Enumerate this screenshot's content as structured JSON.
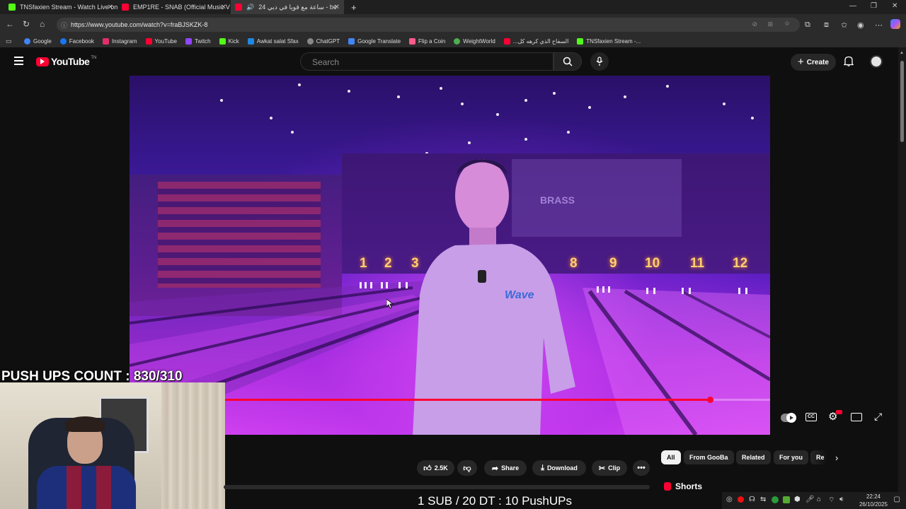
{
  "browser": {
    "tabs": [
      {
        "title": "TNSfaxien Stream - Watch Live on",
        "favicon_color": "#53fc18"
      },
      {
        "title": "EMP1RE - SNAB (Official Music V",
        "favicon_color": "#ff0033"
      },
      {
        "title": "24 ساعة مع قويا في دبي - be",
        "favicon_color": "#ff0033"
      }
    ],
    "new_tab": "+",
    "url": "https://www.youtube.com/watch?v=fraBJSKZK-8",
    "bookmarks": [
      {
        "label": "Google",
        "color": "#4285f4"
      },
      {
        "label": "Facebook",
        "color": "#1877f2"
      },
      {
        "label": "Instagram",
        "color": "#e1306c"
      },
      {
        "label": "YouTube",
        "color": "#ff0033"
      },
      {
        "label": "Twitch",
        "color": "#9146ff"
      },
      {
        "label": "Kick",
        "color": "#53fc18"
      },
      {
        "label": "Awkat salat Sfax",
        "color": "#1e88e5"
      },
      {
        "label": "ChatGPT",
        "color": "#888888"
      },
      {
        "label": "Google Translate",
        "color": "#4285f4"
      },
      {
        "label": "Flip a Coin",
        "color": "#ff5a8a"
      },
      {
        "label": "WeightWorld",
        "color": "#4caf50"
      },
      {
        "label": "...السفاح الذي كرهه كل",
        "color": "#ff0033"
      },
      {
        "label": "TNSfaxien Stream -...",
        "color": "#53fc18"
      }
    ]
  },
  "youtube": {
    "logo_text": "YouTube",
    "logo_sup": "TN",
    "search_placeholder": "Search",
    "create_label": "Create",
    "actions": {
      "likes": "2.5K",
      "share": "Share",
      "download": "Download",
      "clip": "Clip"
    },
    "chips": [
      "All",
      "From GooBa",
      "Related",
      "For you",
      "Re"
    ],
    "shorts_label": "Shorts",
    "progress_fraction": 0.89,
    "lane_numbers": [
      "1",
      "2",
      "3",
      "8",
      "9",
      "10",
      "11",
      "12"
    ],
    "shirt_text": "Wave",
    "poster_text": "BRASS"
  },
  "overlay": {
    "pushups_count": "PUSH UPS COUNT : 830/310",
    "subs_rule": "1 SUB / 20 DT : 10 PushUPs"
  },
  "tray": {
    "time": "22:24",
    "date": "26/10/2025"
  }
}
